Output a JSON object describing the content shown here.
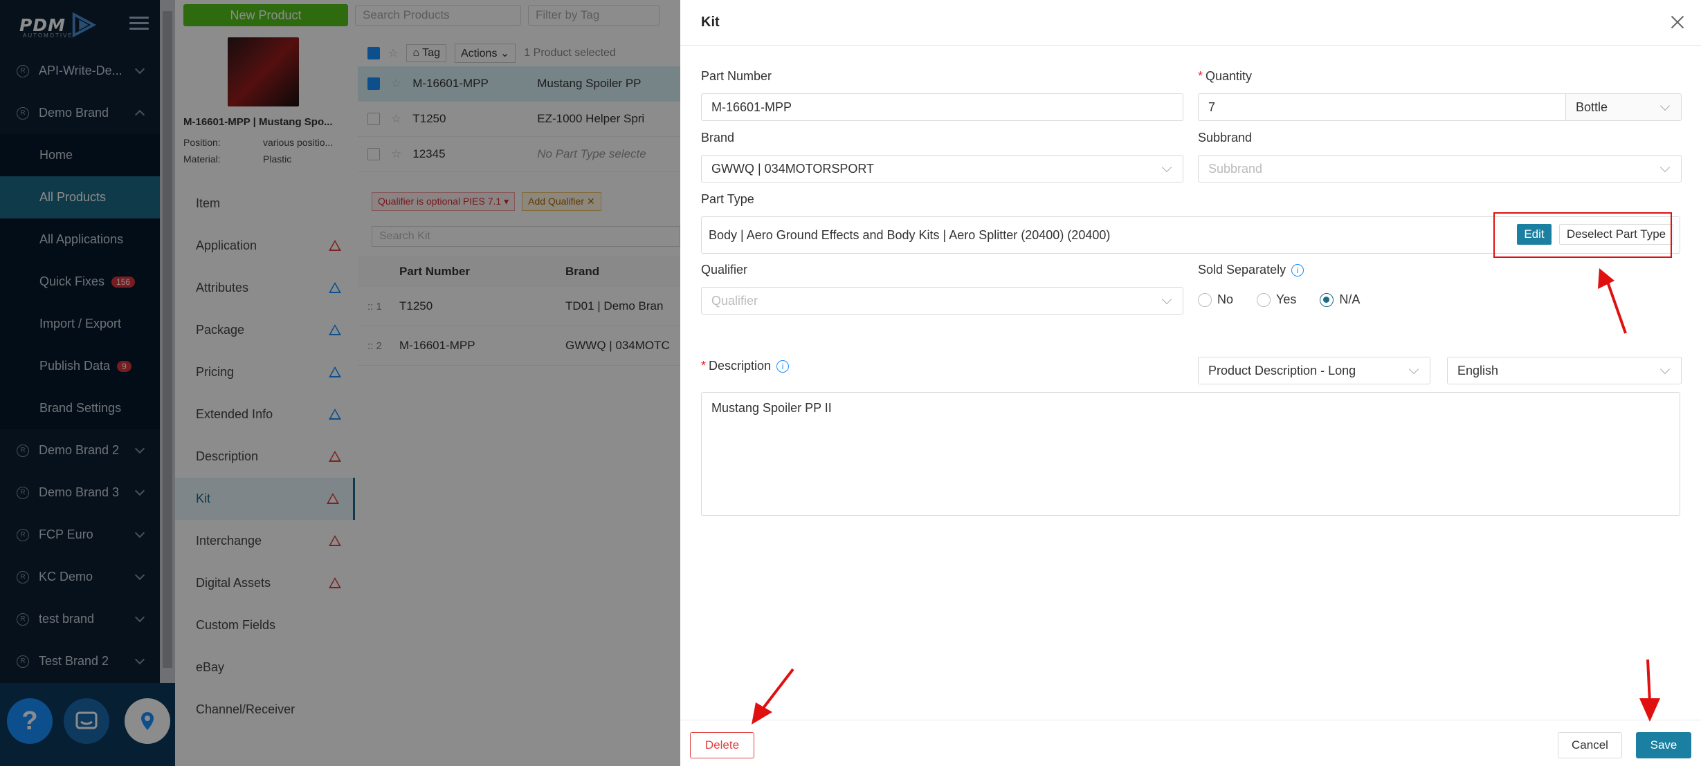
{
  "sidebar": {
    "logo_text": "PDM",
    "logo_sub": "AUTOMOTIVE",
    "brands_top": [
      {
        "label": "API-Write-De...",
        "expanded": false
      }
    ],
    "active_brand": {
      "label": "Demo Brand"
    },
    "sub_items": [
      {
        "label": "Home",
        "badge": ""
      },
      {
        "label": "All Products",
        "badge": ""
      },
      {
        "label": "All Applications",
        "badge": ""
      },
      {
        "label": "Quick Fixes",
        "badge": "156"
      },
      {
        "label": "Import / Export",
        "badge": ""
      },
      {
        "label": "Publish Data",
        "badge": "9"
      },
      {
        "label": "Brand Settings",
        "badge": ""
      }
    ],
    "brands_bottom": [
      {
        "label": "Demo Brand 2"
      },
      {
        "label": "Demo Brand 3"
      },
      {
        "label": "FCP Euro"
      },
      {
        "label": "KC Demo"
      },
      {
        "label": "test brand"
      },
      {
        "label": "Test Brand 2"
      }
    ],
    "help_label": "?"
  },
  "middle": {
    "new_product_label": "New Product",
    "search_placeholder": "Search Products",
    "filter_placeholder": "Filter by Tag",
    "product": {
      "title": "M-16601-MPP | Mustang Spo...",
      "position_label": "Position:",
      "position_value": "various positio...",
      "material_label": "Material:",
      "material_value": "Plastic"
    },
    "list_toolbar": {
      "tag_label": "Tag",
      "actions_label": "Actions",
      "selected_text": "1 Product selected"
    },
    "rows": [
      {
        "pn": "M-16601-MPP",
        "desc": "Mustang Spoiler PP"
      },
      {
        "pn": "T1250",
        "desc": "EZ-1000 Helper Spri"
      },
      {
        "pn": "12345",
        "desc": "No Part Type selecte"
      }
    ],
    "tabs": [
      {
        "label": "Item",
        "warn": ""
      },
      {
        "label": "Application",
        "warn": "red"
      },
      {
        "label": "Attributes",
        "warn": "blue"
      },
      {
        "label": "Package",
        "warn": "blue"
      },
      {
        "label": "Pricing",
        "warn": "blue"
      },
      {
        "label": "Extended Info",
        "warn": "blue"
      },
      {
        "label": "Description",
        "warn": "red"
      },
      {
        "label": "Kit",
        "warn": "red"
      },
      {
        "label": "Interchange",
        "warn": "red"
      },
      {
        "label": "Digital Assets",
        "warn": "red"
      },
      {
        "label": "Custom Fields",
        "warn": ""
      },
      {
        "label": "eBay",
        "warn": ""
      },
      {
        "label": "Channel/Receiver",
        "warn": ""
      }
    ],
    "kit": {
      "qualifier_tag": "Qualifier is optional PIES 7.1",
      "add_qualifier": "Add Qualifier",
      "search_placeholder": "Search Kit",
      "col_part_number": "Part Number",
      "col_brand": "Brand",
      "rows": [
        {
          "idx": ":: 1",
          "pn": "T1250",
          "brand": "TD01 | Demo Bran"
        },
        {
          "idx": ":: 2",
          "pn": "M-16601-MPP",
          "brand": "GWWQ | 034MOTC"
        }
      ]
    }
  },
  "drawer": {
    "title": "Kit",
    "part_number_label": "Part Number",
    "part_number_value": "M-16601-MPP",
    "quantity_label": "Quantity",
    "quantity_value": "7",
    "unit_value": "Bottle",
    "brand_label": "Brand",
    "brand_value": "GWWQ | 034MOTORSPORT",
    "subbrand_label": "Subbrand",
    "subbrand_placeholder": "Subbrand",
    "part_type_label": "Part Type",
    "part_type_value": "Body | Aero Ground Effects and Body Kits | Aero Splitter (20400) (20400)",
    "edit_label": "Edit",
    "deselect_label": "Deselect Part Type",
    "qualifier_label": "Qualifier",
    "qualifier_placeholder": "Qualifier",
    "sold_separately_label": "Sold Separately",
    "sold_options": [
      "No",
      "Yes",
      "N/A"
    ],
    "sold_selected": "N/A",
    "description_label": "Description",
    "description_type": "Product Description - Long",
    "language": "English",
    "description_value": "Mustang Spoiler PP II",
    "delete_label": "Delete",
    "cancel_label": "Cancel",
    "save_label": "Save"
  },
  "colors": {
    "sidebar_bg": "#0c1f33",
    "accent": "#1a7fa0",
    "new_product_green": "#52c41a",
    "annotation_red": "#e01010"
  }
}
